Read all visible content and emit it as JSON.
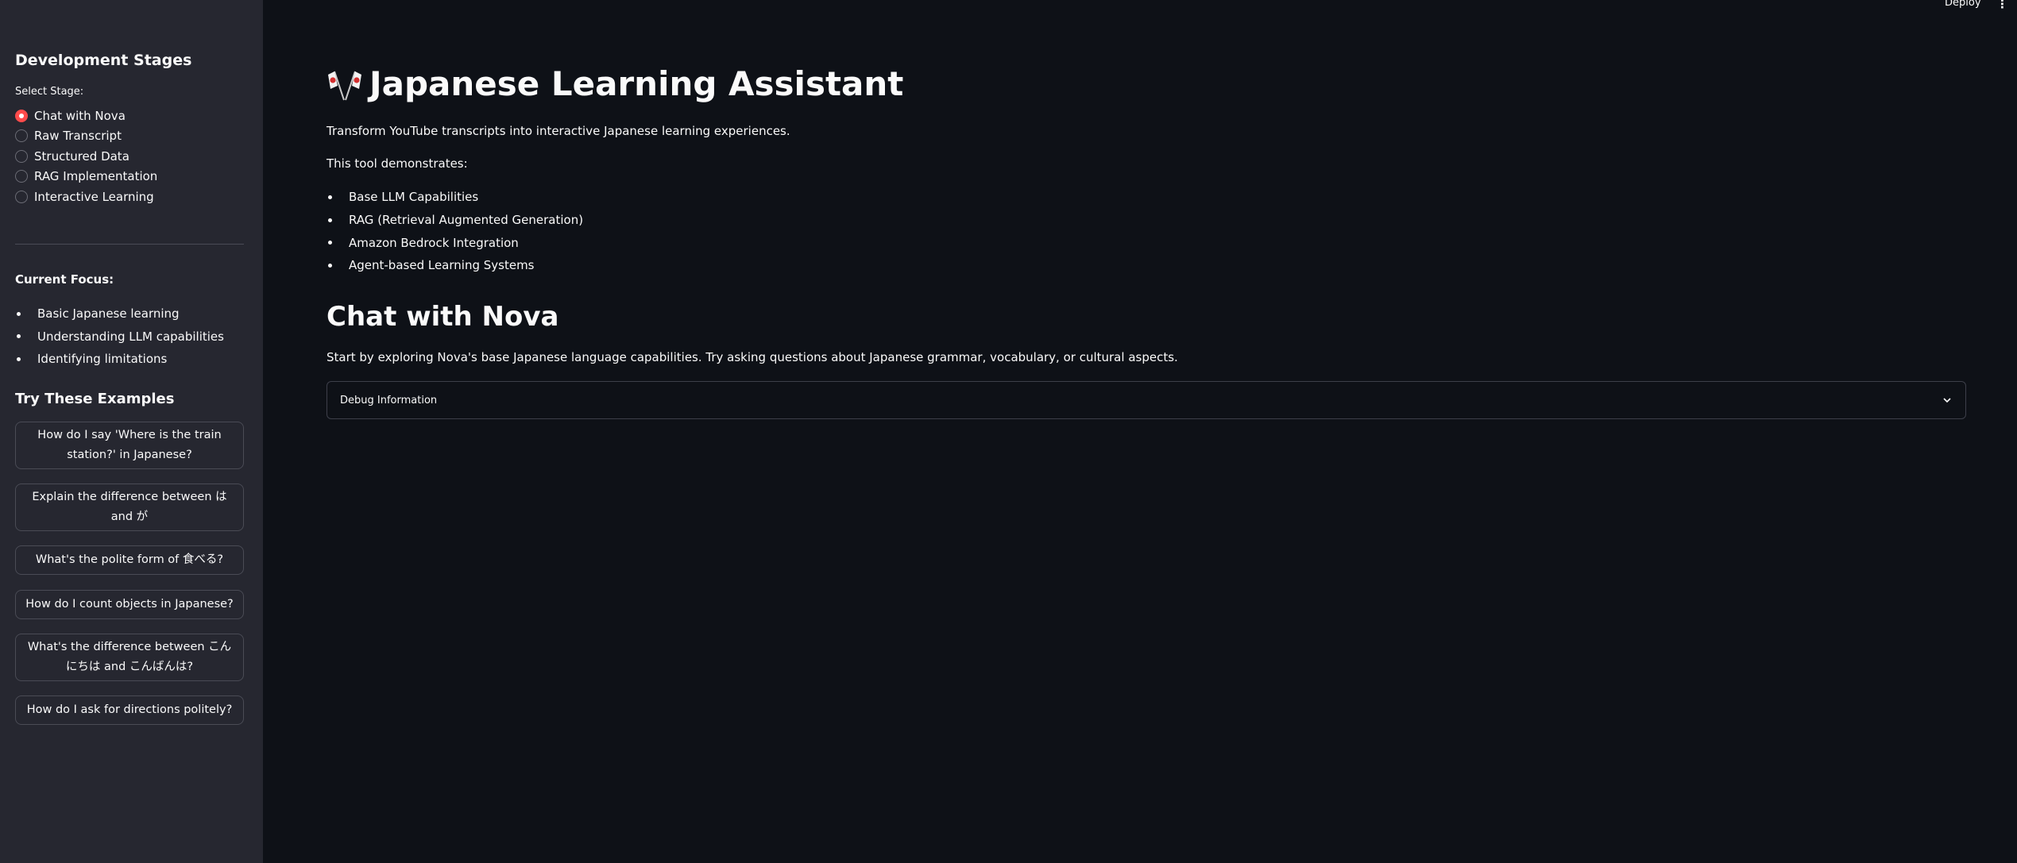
{
  "sidebar": {
    "heading": "Development Stages",
    "select_label": "Select Stage:",
    "stages": [
      {
        "label": "Chat with Nova",
        "selected": true
      },
      {
        "label": "Raw Transcript",
        "selected": false
      },
      {
        "label": "Structured Data",
        "selected": false
      },
      {
        "label": "RAG Implementation",
        "selected": false
      },
      {
        "label": "Interactive Learning",
        "selected": false
      }
    ],
    "focus_title": "Current Focus:",
    "focus_items": [
      "Basic Japanese learning",
      "Understanding LLM capabilities",
      "Identifying limitations"
    ],
    "examples_title": "Try These Examples",
    "examples": [
      "How do I say 'Where is the train station?' in Japanese?",
      "Explain the difference between は and が",
      "What's the polite form of 食べる?",
      "How do I count objects in Japanese?",
      "What's the difference between こんにちは and こんばんは?",
      "How do I ask for directions politely?"
    ]
  },
  "toolbar": {
    "deploy_label": "Deploy",
    "menu_icon": "⋮"
  },
  "main": {
    "title": "Japanese Learning Assistant",
    "title_icon": "crossed-flags-icon",
    "intro": "Transform YouTube transcripts into interactive Japanese learning experiences.",
    "demonstrates_label": "This tool demonstrates:",
    "features": [
      "Base LLM Capabilities",
      "RAG (Retrieval Augmented Generation)",
      "Amazon Bedrock Integration",
      "Agent-based Learning Systems"
    ],
    "section_title": "Chat with Nova",
    "section_desc": "Start by exploring Nova's base Japanese language capabilities. Try asking questions about Japanese grammar, vocabulary, or cultural aspects.",
    "expander_label": "Debug Information"
  },
  "colors": {
    "background": "#0e1117",
    "sidebar": "#262730",
    "accent": "#ff4b4b"
  }
}
